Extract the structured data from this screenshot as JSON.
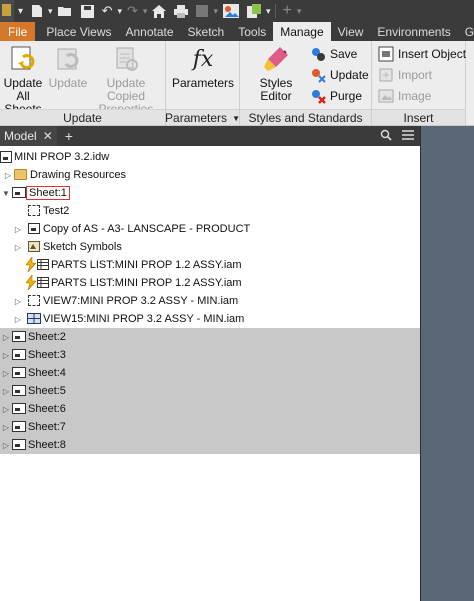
{
  "colors": {
    "file_tab": "#d6782a",
    "dark_bar": "#3b3b3b",
    "ribbon_bg": "#ededed",
    "canvas": "#5b6677",
    "sheet_row_grey": "#c8c8c8",
    "selection_outline": "#d33333"
  },
  "qat": {
    "icons": [
      "new-icon",
      "open-icon",
      "save-icon",
      "undo-icon",
      "redo-icon",
      "home-icon",
      "print-icon",
      "measure-icon",
      "appearance-icon",
      "material-icon",
      "add-icon"
    ]
  },
  "tabs": [
    "File",
    "Place Views",
    "Annotate",
    "Sketch",
    "Tools",
    "Manage",
    "View",
    "Environments",
    "Get"
  ],
  "active_tab": "Manage",
  "ribbon": {
    "update_panel": {
      "title": "Update",
      "update_all_line1": "Update",
      "update_all_line2": "All Sheets",
      "update": "Update",
      "update_copied_line1": "Update Copied",
      "update_copied_line2": "Properties"
    },
    "parameters_panel": {
      "title": "Parameters",
      "parameters": "Parameters"
    },
    "styles_panel": {
      "title": "Styles and Standards",
      "styles_editor": "Styles Editor",
      "save": "Save",
      "update": "Update",
      "purge": "Purge"
    },
    "insert_panel": {
      "title": "Insert",
      "insert_object": "Insert Object",
      "import": "Import",
      "image": "Image"
    }
  },
  "browser": {
    "tab_label": "Model",
    "close": "✕",
    "add": "+"
  },
  "tree": {
    "root": "MINI PROP 3.2.idw",
    "drawing_resources": "Drawing Resources",
    "sheet1": "Sheet:1",
    "sheet1_children": [
      "Test2",
      "Copy of AS - A3- LANSCAPE - PRODUCT",
      "Sketch Symbols",
      "PARTS LIST:MINI PROP 1.2 ASSY.iam",
      "PARTS LIST:MINI PROP 1.2 ASSY.iam",
      "VIEW7:MINI PROP 3.2 ASSY - MIN.iam",
      "VIEW15:MINI PROP 3.2 ASSY - MIN.iam"
    ],
    "other_sheets": [
      "Sheet:2",
      "Sheet:3",
      "Sheet:4",
      "Sheet:5",
      "Sheet:6",
      "Sheet:7",
      "Sheet:8"
    ]
  }
}
